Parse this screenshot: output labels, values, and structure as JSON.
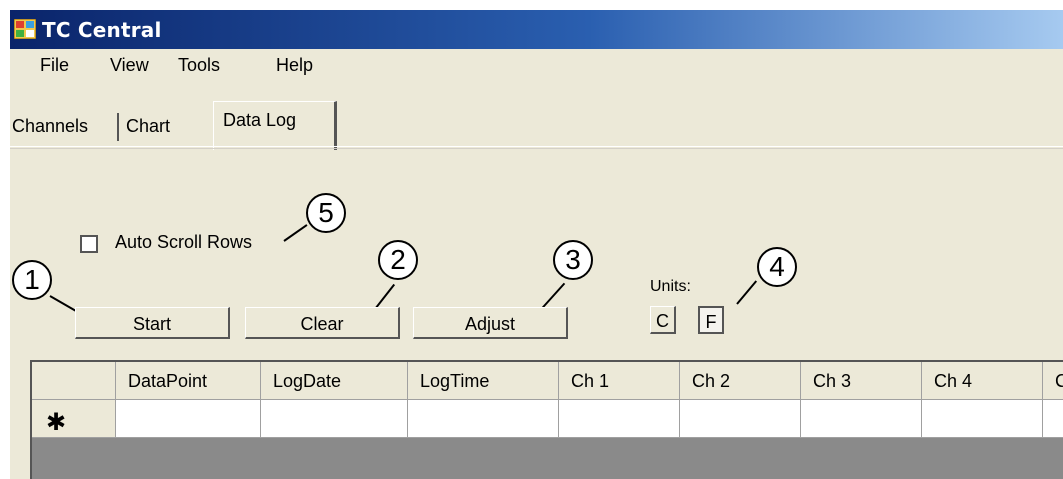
{
  "window": {
    "title": "TC Central"
  },
  "menu": [
    "File",
    "View",
    "Tools",
    "Help"
  ],
  "tabs": [
    {
      "label": "Channels",
      "active": false
    },
    {
      "label": "Chart",
      "active": false
    },
    {
      "label": "Data Log",
      "active": true
    }
  ],
  "controls": {
    "auto_scroll_label": "Auto Scroll Rows",
    "auto_scroll_checked": false,
    "start_label": "Start",
    "clear_label": "Clear",
    "adjust_label": "Adjust",
    "units_label": "Units:",
    "unit_c": "C",
    "unit_f": "F",
    "selected_unit": "F"
  },
  "callouts": [
    "1",
    "2",
    "3",
    "4",
    "5"
  ],
  "grid": {
    "columns": [
      "",
      "DataPoint",
      "LogDate",
      "LogTime",
      "Ch 1",
      "Ch 2",
      "Ch 3",
      "Ch 4",
      "C"
    ],
    "new_row_marker": "✱"
  },
  "colors": {
    "titlebar_start": "#0a246a",
    "titlebar_end": "#a6caf0",
    "window_bg": "#ece9d8",
    "grid_bg": "#8a8a8a"
  },
  "icons": {
    "app": "app-window-icon"
  }
}
